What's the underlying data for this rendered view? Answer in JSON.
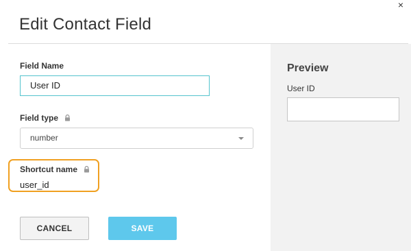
{
  "dialog": {
    "title": "Edit Contact Field",
    "close_symbol": "×"
  },
  "form": {
    "field_name": {
      "label": "Field Name",
      "value": "User ID"
    },
    "field_type": {
      "label": "Field type",
      "selected": "number",
      "locked_icon": "lock-icon"
    },
    "shortcut_name": {
      "label": "Shortcut name",
      "value": "user_id",
      "locked_icon": "lock-icon"
    }
  },
  "buttons": {
    "cancel_label": "CANCEL",
    "save_label": "SAVE"
  },
  "preview": {
    "title": "Preview",
    "field_label": "User ID"
  },
  "colors": {
    "accent_border": "#53c3cd",
    "save_button": "#5ec8ec",
    "highlight": "#f0a020",
    "preview_bg": "#f2f2f2"
  }
}
